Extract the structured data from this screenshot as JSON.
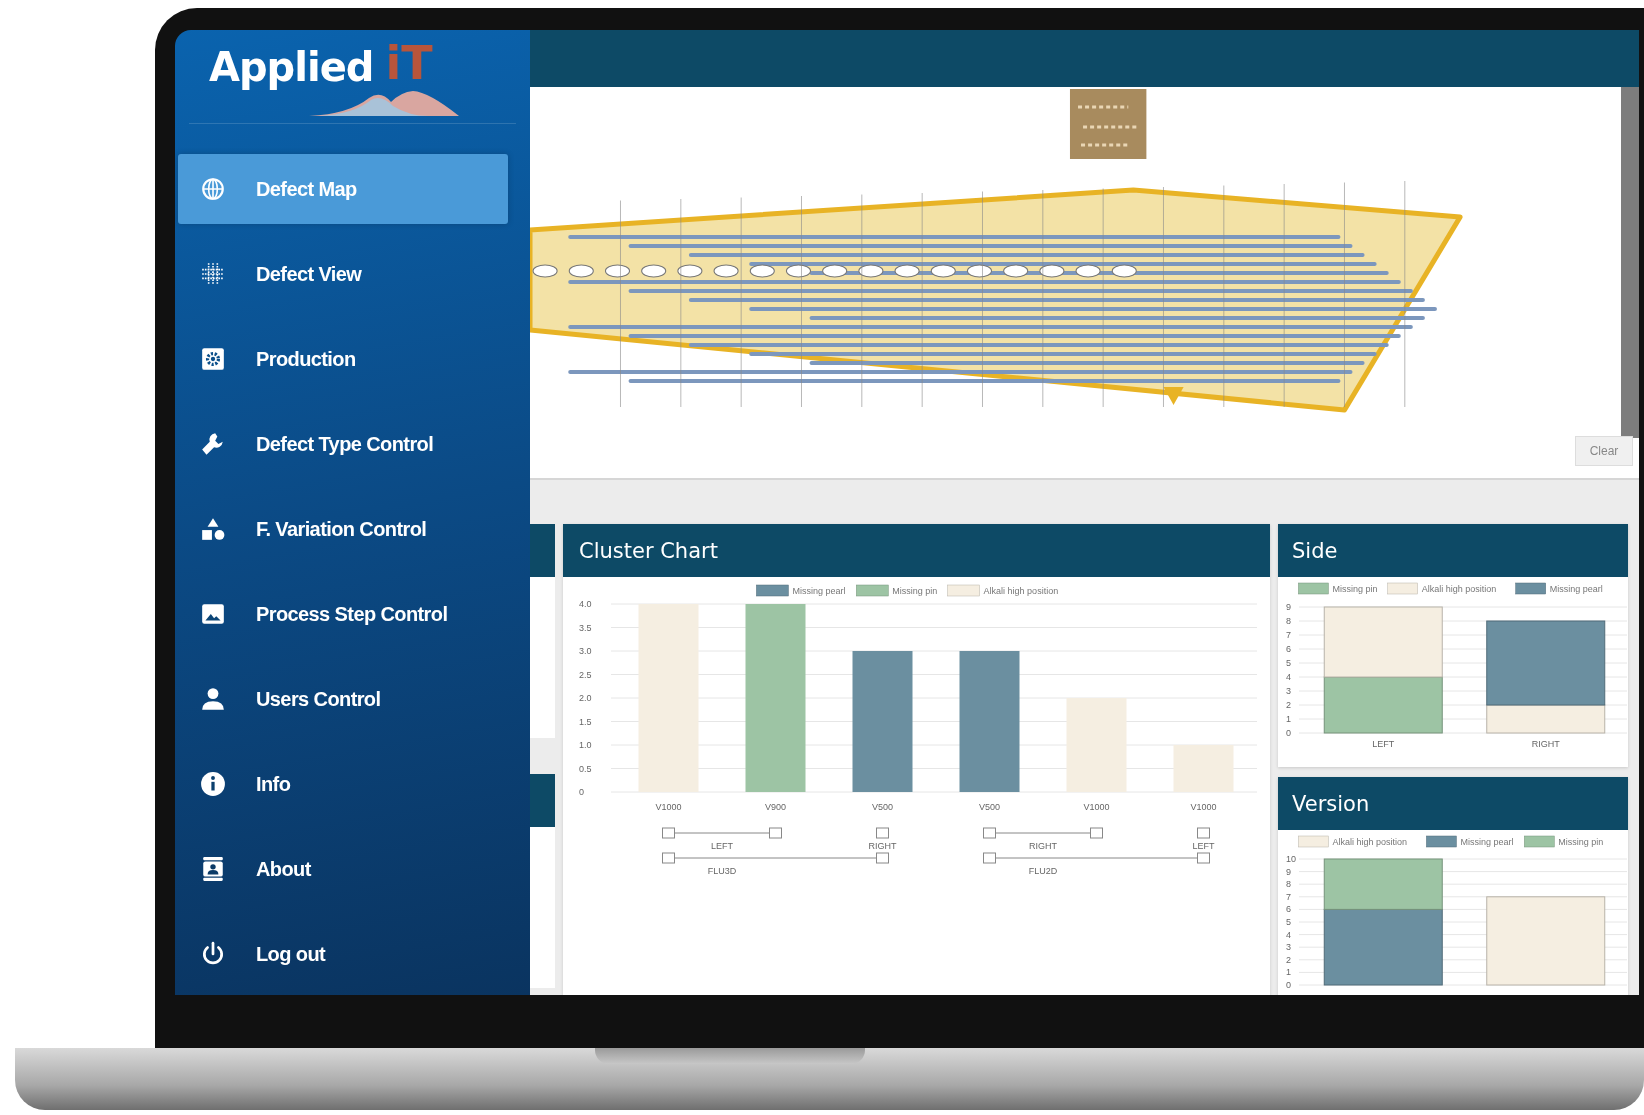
{
  "logo": {
    "word": "Applied",
    "mark": "iT"
  },
  "nav": [
    {
      "label": "Defect Map",
      "kind": "globe",
      "selected": true
    },
    {
      "label": "Defect View",
      "kind": "grid",
      "selected": false
    },
    {
      "label": "Production",
      "kind": "gear",
      "selected": false
    },
    {
      "label": "Defect Type Control",
      "kind": "wrench",
      "selected": false
    },
    {
      "label": "F. Variation Control",
      "kind": "shapes",
      "selected": false
    },
    {
      "label": "Process Step Control",
      "kind": "image",
      "selected": false
    },
    {
      "label": "Users Control",
      "kind": "user",
      "selected": false
    },
    {
      "label": "Info",
      "kind": "info",
      "selected": false
    },
    {
      "label": "About",
      "kind": "badge",
      "selected": false
    },
    {
      "label": "Log out",
      "kind": "power",
      "selected": false
    }
  ],
  "map": {
    "button": "Clear"
  },
  "cluster": {
    "title": "Cluster Chart",
    "chart_data": {
      "type": "bar",
      "categories": [
        "V1000",
        "V900",
        "V500",
        "V500",
        "V1000",
        "V1000"
      ],
      "series": [
        {
          "name": "Missing pearl",
          "color": "#6b8fa0",
          "values": [
            null,
            null,
            3,
            3,
            null,
            null
          ]
        },
        {
          "name": "Missing pin",
          "color": "#9dc4a4",
          "values": [
            null,
            4,
            null,
            null,
            null,
            null
          ]
        },
        {
          "name": "Alkali high position",
          "color": "#f5eee1",
          "values": [
            4,
            null,
            null,
            null,
            2,
            1
          ]
        }
      ],
      "ylim": [
        0,
        4
      ],
      "grid": true,
      "legend": "top",
      "yticks": [
        {
          "value": 0,
          "label": "0"
        },
        0.5,
        {
          "value": 1,
          "label": "1.0"
        },
        1.5,
        {
          "value": 2,
          "label": "2.0"
        },
        2.5,
        {
          "value": 3,
          "label": "3.0"
        },
        3.5,
        {
          "value": 4,
          "label": "4.0"
        }
      ]
    },
    "groups": [
      {
        "label": "FLU3D",
        "sides": [
          "LEFT",
          "RIGHT"
        ]
      },
      {
        "label": "FLU2D",
        "sides": [
          "RIGHT",
          "LEFT"
        ]
      }
    ]
  },
  "side": {
    "title": "Side",
    "chart_data": {
      "type": "bar",
      "stacked": true,
      "categories": [
        "LEFT",
        "RIGHT"
      ],
      "series": [
        {
          "name": "Missing pin",
          "color": "#9dc4a4",
          "values": [
            4,
            0
          ]
        },
        {
          "name": "Alkali high position",
          "color": "#f5eee1",
          "values": [
            5,
            2
          ]
        },
        {
          "name": "Missing pearl",
          "color": "#6b8fa0",
          "values": [
            0,
            6
          ]
        }
      ],
      "ylim": [
        0,
        9
      ],
      "grid": true,
      "legend": "top",
      "yticks": [
        0,
        1,
        2,
        3,
        4,
        5,
        6,
        7,
        8,
        9
      ]
    }
  },
  "version": {
    "title": "Version",
    "chart_data": {
      "type": "bar",
      "stacked": true,
      "series": [
        {
          "name": "Alkali high position",
          "color": "#f5eee1",
          "values": [
            0,
            7
          ]
        },
        {
          "name": "Missing pearl",
          "color": "#6b8fa0",
          "values": [
            6,
            0
          ]
        },
        {
          "name": "Missing pin",
          "color": "#9dc4a4",
          "values": [
            4,
            0
          ]
        }
      ],
      "ylim": [
        0,
        10
      ],
      "grid": true,
      "legend": "top",
      "yticks": [
        0,
        1,
        2,
        3,
        4,
        5,
        6,
        7,
        8,
        9,
        10
      ]
    }
  }
}
